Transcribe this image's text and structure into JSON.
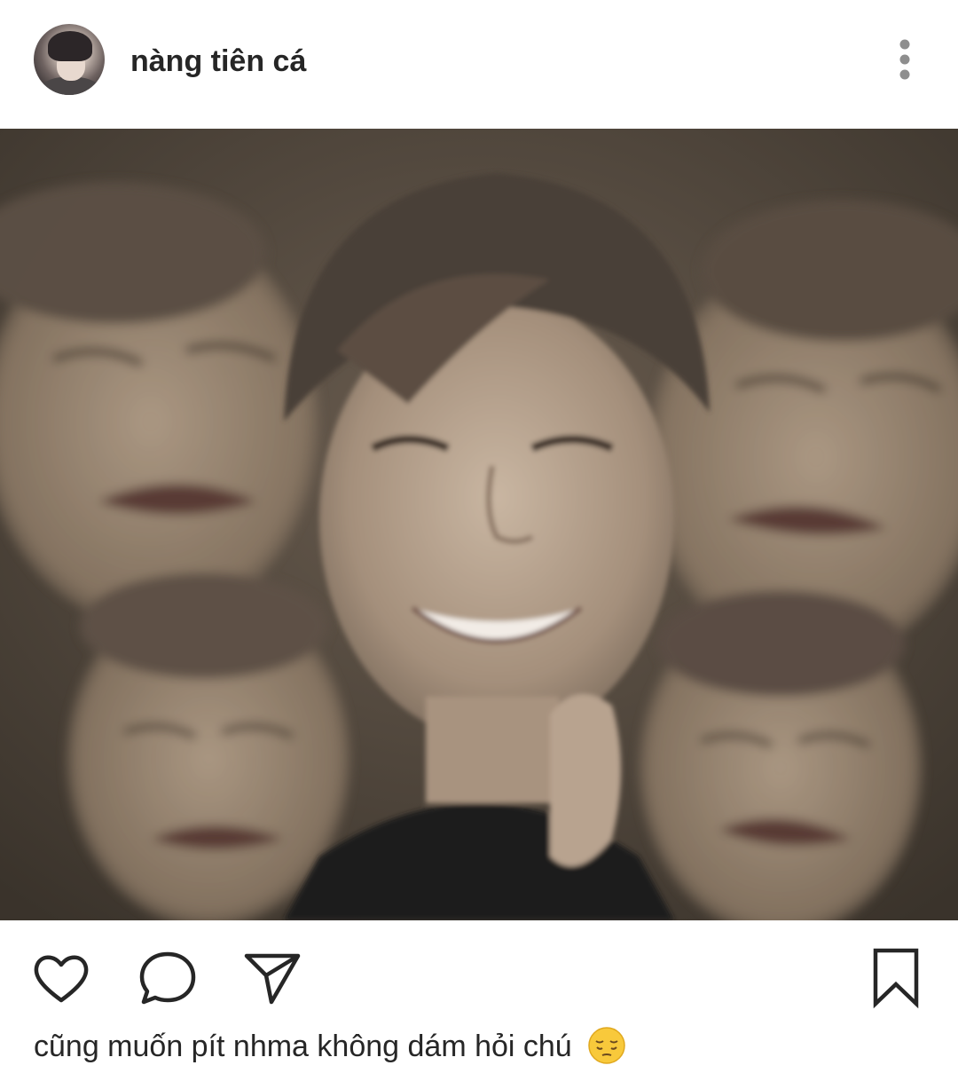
{
  "post": {
    "username": "nàng tiên cá",
    "avatar_icon": "profile-avatar",
    "more_icon": "vertical-dots-icon",
    "caption": "cũng muốn pít nhma không dám hỏi chú",
    "caption_emoji": "pensive-face-emoji",
    "actions": {
      "like_icon": "heart-icon",
      "comment_icon": "comment-bubble-icon",
      "share_icon": "paper-plane-icon",
      "save_icon": "bookmark-icon"
    }
  }
}
